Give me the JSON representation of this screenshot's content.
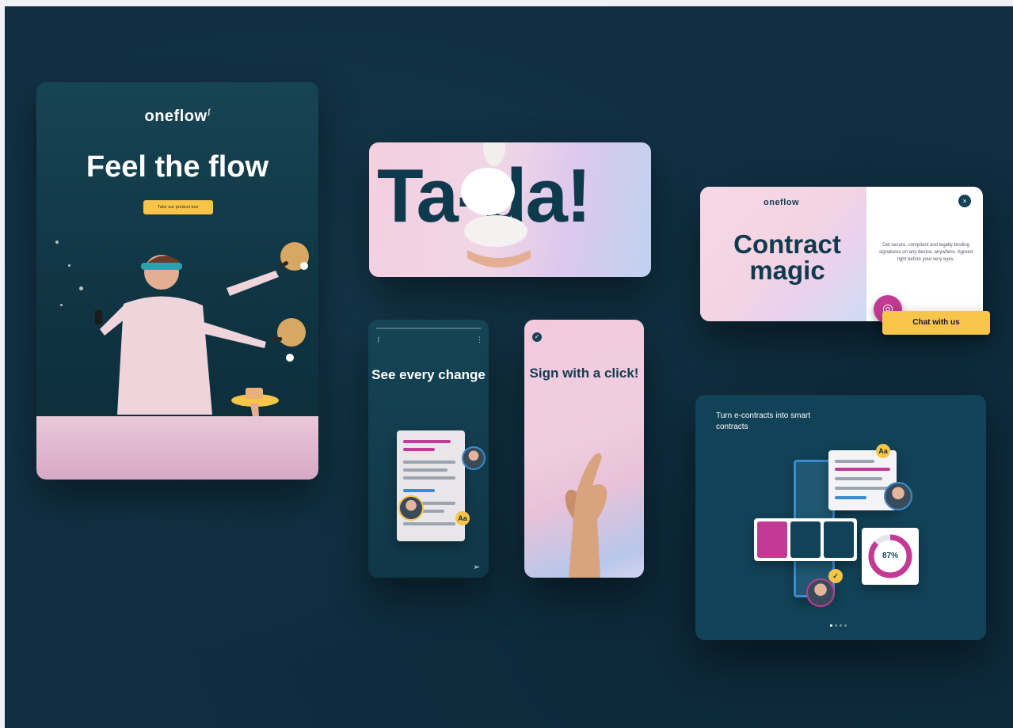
{
  "brand": {
    "logo": "oneflow",
    "logo_mark": "∫"
  },
  "poster": {
    "headline": "Feel the flow",
    "cta": "Take our product tour"
  },
  "tada": {
    "text": "Ta-da!"
  },
  "contract": {
    "logo": "oneflow",
    "title": "Contract magic",
    "description": "Get secure, compliant and legally-binding signatures on any device, anywhere. Agreed right before your very eyes.",
    "chat_label": "Chat with us"
  },
  "see": {
    "title": "See every change",
    "badge": "Aa"
  },
  "sign": {
    "title": "Sign with a click!"
  },
  "turn": {
    "title": "Turn e-contracts into smart contracts",
    "badge": "Aa",
    "progress_label": "87%",
    "progress": 0.87
  },
  "colors": {
    "background": "#0f2e40",
    "accent_yellow": "#f6c54a",
    "accent_magenta": "#c33a94",
    "accent_blue": "#3a8cd0"
  }
}
